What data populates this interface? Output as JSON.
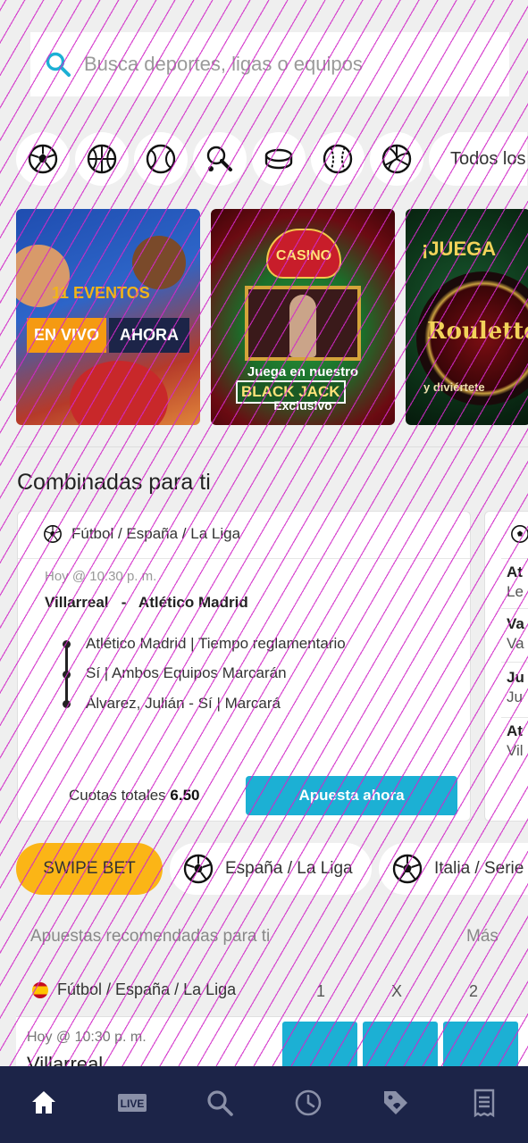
{
  "search": {
    "placeholder": "Busca deportes, ligas o equipos"
  },
  "sports": {
    "items": [
      "soccer-ball-icon",
      "basketball-icon",
      "tennis-ball-icon",
      "table-tennis-icon",
      "hockey-puck-icon",
      "baseball-icon",
      "volleyball-icon"
    ],
    "all_label": "Todos los"
  },
  "banners": {
    "live": {
      "events": "11 EVENTOS",
      "tag1": "EN VIVO",
      "tag2": "AHORA"
    },
    "casino": {
      "logo": "CASINO",
      "line1": "Juega en nuestro",
      "line2": "BLACK JACK",
      "line3": "Exclusivo"
    },
    "roulette": {
      "heading": "¡JUEGA",
      "title": "Roulette",
      "sub": "y diviértete"
    }
  },
  "combos": {
    "title": "Combinadas para ti",
    "card": {
      "breadcrumb": "Fútbol / España / La Liga",
      "time": "Hoy @ 10:30 p. m.",
      "home": "Villarreal",
      "vs": "-",
      "away": "Atlético Madrid",
      "selections": [
        "Atlético Madrid | Tiempo reglamentario",
        "Sí | Ambos Equipos Marcarán",
        "Álvarez, Julián - Sí | Marcará"
      ],
      "total_label": "Cuotas totales",
      "total_value": "6.50",
      "cta": "Apuesta ahora"
    },
    "peek": [
      {
        "bold": "At",
        "sub": "Le"
      },
      {
        "bold": "Va",
        "sub": "Va"
      },
      {
        "bold": "Ju",
        "sub": "Ju"
      },
      {
        "bold": "At",
        "sub": "Vil"
      }
    ]
  },
  "chips": {
    "swipe": "SWIPE BET",
    "items": [
      "España / La Liga",
      "Italia / Serie"
    ]
  },
  "recommended": {
    "title": "Apuestas recomendadas para ti",
    "more": "Más",
    "league": "Fútbol / España / La Liga",
    "cols": [
      "1",
      "X",
      "2"
    ],
    "time": "Hoy @ 10:30 p. m.",
    "team": "Villarreal"
  },
  "nav": [
    "home-icon",
    "live-icon",
    "search-icon",
    "history-icon",
    "promotions-icon",
    "betslip-icon"
  ],
  "colors": {
    "accent": "#1cb0d4",
    "swipe": "#fbb516",
    "nav": "#1c2448",
    "orange": "#f59a12"
  }
}
